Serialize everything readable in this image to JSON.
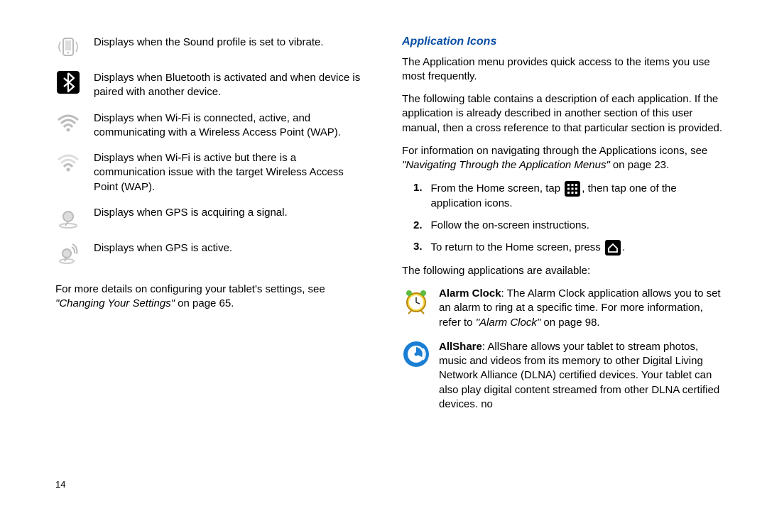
{
  "left": {
    "rows": [
      {
        "text": "Displays when the Sound profile is set to vibrate."
      },
      {
        "text": "Displays when Bluetooth is activated and when device is paired with another device."
      },
      {
        "text": "Displays when Wi-Fi is connected, active, and communicating with a Wireless Access Point (WAP)."
      },
      {
        "text": "Displays when Wi-Fi is active but there is a communication issue with the target Wireless Access Point (WAP)."
      },
      {
        "text": "Displays when GPS is acquiring a signal."
      },
      {
        "text": "Displays when GPS is active."
      }
    ],
    "footer_pre": "For more details on configuring your tablet's settings, see ",
    "footer_link": "\"Changing Your Settings\"",
    "footer_post": " on page 65."
  },
  "right": {
    "title": "Application Icons",
    "p1": "The Application menu provides quick access to the items you use most frequently.",
    "p2": "The following table contains a description of each application. If the application is already described in another section of this user manual, then a cross reference to that particular section is provided.",
    "p3_pre": "For information on navigating through the Applications icons, see ",
    "p3_link": "\"Navigating Through the Application Menus\"",
    "p3_post": " on page 23.",
    "steps": {
      "s1_num": "1.",
      "s1_a": "From the Home screen, tap ",
      "s1_b": ", then tap one of the application icons.",
      "s2_num": "2.",
      "s2": "Follow the on-screen instructions.",
      "s3_num": "3.",
      "s3_a": "To return to the Home screen, press ",
      "s3_b": "."
    },
    "p4": "The following applications are available:",
    "apps": {
      "alarm_label": "Alarm Clock",
      "alarm_body": ": The Alarm Clock application allows you to set an alarm to ring at a specific time. For more information, refer to ",
      "alarm_link": "\"Alarm Clock\"",
      "alarm_post": "  on page 98.",
      "allshare_label": "AllShare",
      "allshare_body": ": AllShare allows your tablet to stream photos, music and videos from its memory to other Digital Living Network Alliance (DLNA) certified devices. Your tablet can also play digital content streamed from other DLNA certified devices. no"
    }
  },
  "page": "14"
}
